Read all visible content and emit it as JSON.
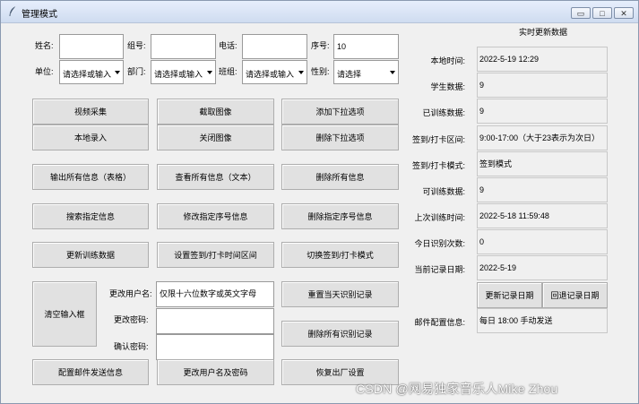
{
  "window": {
    "title": "管理模式",
    "minimize_label": "▭",
    "maximize_label": "□",
    "close_label": "✕"
  },
  "form": {
    "name_label": "姓名:",
    "name_value": "",
    "group_label": "组号:",
    "group_value": "",
    "phone_label": "电话:",
    "phone_value": "",
    "seq_label": "序号:",
    "seq_value": "10",
    "unit_label": "单位:",
    "unit_value": "请选择或输入",
    "dept_label": "部门:",
    "dept_value": "请选择或输入",
    "class_label": "班组:",
    "class_value": "请选择或输入",
    "gender_label": "性别:",
    "gender_value": "请选择"
  },
  "buttons": {
    "video_capture": "视频采集",
    "capture_image": "截取图像",
    "add_dropdown_option": "添加下拉选项",
    "local_entry": "本地录入",
    "close_image": "关闭图像",
    "delete_dropdown_option": "删除下拉选项",
    "export_all_table": "输出所有信息（表格）",
    "view_all_text": "查看所有信息（文本）",
    "delete_all_info": "删除所有信息",
    "search_info": "搜索指定信息",
    "modify_by_seq": "修改指定序号信息",
    "delete_by_seq": "删除指定序号信息",
    "update_training_data": "更新训练数据",
    "set_checkin_interval": "设置签到/打卡时间区间",
    "switch_checkin_mode": "切换签到/打卡模式",
    "clear_inputs": "清空输入框",
    "reset_today_records": "重置当天识别记录",
    "delete_all_records": "删除所有识别记录",
    "config_mail": "配置邮件发送信息",
    "change_credentials": "更改用户名及密码",
    "factory_reset": "恢复出厂设置",
    "update_record_date": "更新记录日期",
    "rollback_record_date": "回退记录日期"
  },
  "account": {
    "username_label": "更改用户名:",
    "username_value": "仅限十六位数字或英文字母",
    "password_label": "更改密码:",
    "password_value": "",
    "confirm_label": "确认密码:",
    "confirm_value": ""
  },
  "realtime": {
    "header": "实时更新数据",
    "local_time_label": "本地时间:",
    "local_time": "2022-5-19 12:29",
    "student_count_label": "学生数据:",
    "student_count": "9",
    "trained_label": "已训练数据:",
    "trained": "9",
    "interval_label": "签到/打卡区间:",
    "interval": "9:00-17:00（大于23表示为次日）",
    "mode_label": "签到/打卡模式:",
    "mode": "签到模式",
    "trainable_label": "可训练数据:",
    "trainable": "9",
    "last_train_label": "上次训练时间:",
    "last_train": "2022-5-18 11:59:48",
    "today_count_label": "今日识别次数:",
    "today_count": "0",
    "record_date_label": "当前记录日期:",
    "record_date": "2022-5-19",
    "mail_label": "邮件配置信息:",
    "mail": "每日 18:00 手动发送"
  },
  "watermark": "CSDN @网易独家音乐人Mike Zhou"
}
